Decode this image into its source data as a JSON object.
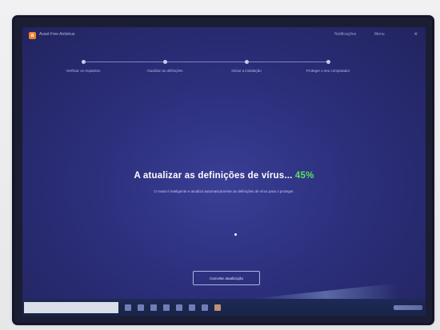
{
  "app": {
    "title": "Avast Free Antivirus",
    "logo_letter": "a",
    "notifications_label": "Notificações",
    "menu_label": "Menu",
    "close_label": "×"
  },
  "steps": [
    {
      "label": "Verificar os requisitos"
    },
    {
      "label": "Atualizar as definições"
    },
    {
      "label": "Iniciar a instalação"
    },
    {
      "label": "Proteger o seu computador"
    }
  ],
  "status": {
    "headline": "A atualizar as definições de vírus...",
    "percent": "45%",
    "percent_value": 45,
    "subline": "O Avast é inteligente e atualiza automaticamente as definições de vírus para o proteger."
  },
  "buttons": {
    "cancel_label": "Cancelar atualização"
  },
  "colors": {
    "accent_orange": "#f0812a",
    "progress_green": "#5ce25c",
    "screen_blue": "#2c2f7c"
  }
}
